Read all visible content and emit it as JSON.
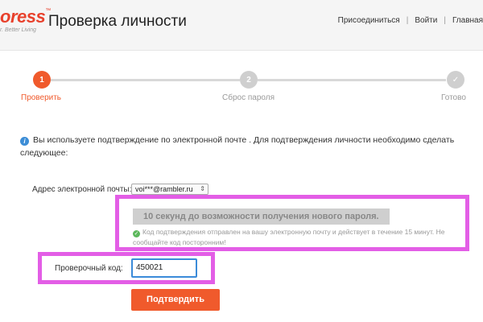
{
  "header": {
    "logo_text": "oress",
    "logo_tm": "™",
    "logo_tagline": "r. Better Living",
    "title": "Проверка личности",
    "nav": [
      "Присоединиться",
      "Войти",
      "Главная"
    ]
  },
  "steps": [
    {
      "number": "1",
      "label": "Проверить",
      "state": "active"
    },
    {
      "number": "2",
      "label": "Сброс пароля",
      "state": "inactive"
    },
    {
      "number": "✓",
      "label": "Готово",
      "state": "inactive"
    }
  ],
  "info": {
    "icon": "info-icon",
    "text": "Вы используете подтверждение по электронной почте . Для подтверждения личности необходимо сделать следующее:"
  },
  "email": {
    "label": "Адрес электронной почты:",
    "selected": "voi***@rambler.ru"
  },
  "timer_text": "10 секунд до возможности получения нового пароля.",
  "sent_message": "Код подтверждения отправлен на вашу электронную почту и действует в течение 15 минут. Не сообщайте код посторонним!",
  "code": {
    "label": "Проверочный код:",
    "value": "450021"
  },
  "submit_label": "Подтвердить",
  "colors": {
    "accent": "#f05a2c",
    "highlight": "#e35ee6",
    "input_focus": "#3b8bd9"
  }
}
